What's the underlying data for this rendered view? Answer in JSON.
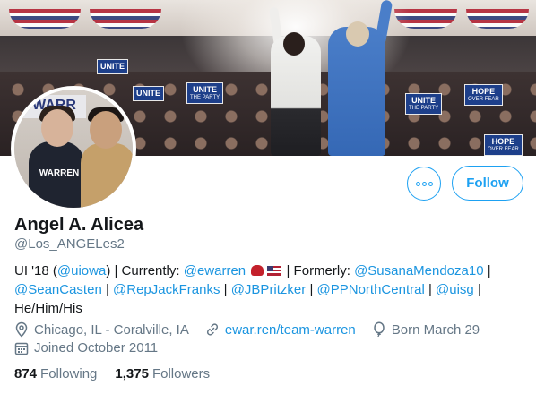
{
  "banner": {
    "signs": [
      {
        "text": "UNITE",
        "sub": ""
      },
      {
        "text": "UNITE",
        "sub": ""
      },
      {
        "text": "UNITE",
        "sub": "THE PARTY"
      },
      {
        "text": "UNITE",
        "sub": "THE PARTY"
      },
      {
        "text": "HOPE",
        "sub": "OVER FEAR"
      },
      {
        "text": "HOPE",
        "sub": "OVER FEAR"
      }
    ]
  },
  "avatar": {
    "shirt_text": "WARREN",
    "banner_text": "WARR"
  },
  "actions": {
    "more_label": "",
    "follow_label": "Follow"
  },
  "profile": {
    "name": "Angel A. Alicea",
    "handle": "@Los_ANGELes2",
    "bio": {
      "ui18_prefix": "UI '18 (",
      "uiowa": "@uiowa",
      "currently": ") | Currently: ",
      "ewarren": "@ewarren",
      "formerly": " | Formerly: ",
      "susana": "@SusanaMendoza10",
      "sep": " | ",
      "seancasten": "@SeanCasten",
      "repjackfranks": "@RepJackFranks",
      "jbpritzker": "@JBPritzker",
      "ppnorthcentral": "@PPNorthCentral",
      "uisg": "@uisg",
      "pronouns": "He/Him/His"
    },
    "location": "Chicago, IL - Coralville, IA",
    "website": "ewar.ren/team-warren",
    "birthday": "Born March 29",
    "joined": "Joined October 2011"
  },
  "stats": {
    "following_count": "874",
    "following_label": "Following",
    "followers_count": "1,375",
    "followers_label": "Followers"
  },
  "colors": {
    "accent": "#1da1f2",
    "link": "#1b95e0",
    "secondary_text": "#657786",
    "primary_text": "#14171a"
  },
  "icons": [
    "location-pin-icon",
    "link-icon",
    "balloon-icon",
    "calendar-icon",
    "more-dots-icon"
  ]
}
